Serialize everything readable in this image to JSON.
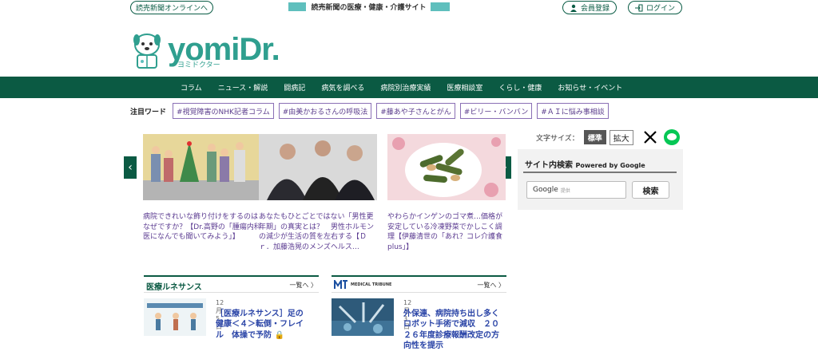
{
  "header": {
    "yomiuri_link": "読売新聞オンラインへ",
    "tagline": "読売新聞の医療・健康・介護サイト",
    "register": "会員登録",
    "login": "ログイン",
    "logo_text": "yomiDr.",
    "logo_kana": "ヨミドクター"
  },
  "nav": [
    "コラム",
    "ニュース・解説",
    "闘病記",
    "病気を調べる",
    "病院別治療実績",
    "医療相談室",
    "くらし・健康",
    "お知らせ・イベント"
  ],
  "attention": {
    "label": "注目ワード",
    "tags": [
      "#視覚障害のNHK記者コラム",
      "#由美かおるさんの呼吸法",
      "#藤あや子さんとがん",
      "#ビリー・バンバン",
      "#ＡＩに悩み事相談"
    ]
  },
  "carousel": [
    {
      "caption": "病院できれいな飾り付けをするのはなぜですか？【Dr.高野の「腫瘍内科医になんでも聞いてみよう」】"
    },
    {
      "caption": "あなたもひとごとではない「男性更年期」の真実とは？　男性ホルモンの減少が生活の質を左右する【Ｄｒ．加藤浩晃のメンズヘルス…"
    },
    {
      "caption": "やわらかインゲンのゴマ煮…価格が安定している冷凍野菜でかしこく調理【伊藤清世の「あれ？コレ介護食 plus」】"
    }
  ],
  "font_size": {
    "label": "文字サイズ：",
    "standard": "標準",
    "large": "拡大"
  },
  "search": {
    "title": "サイト内検索",
    "powered": "Powered by Google",
    "input_brand": "Google",
    "input_sub": "提供",
    "button": "検索"
  },
  "sections": [
    {
      "title": "医療ルネサンス",
      "more": "一覧へ",
      "date": "12月5日",
      "article_title": "［医療ルネサンス］足の健康＜４＞転倒・フレイル　体操で予防"
    },
    {
      "title": "MEDICAL TRIBUNE",
      "more": "一覧へ",
      "date": "12月3日",
      "article_title": "外保連、病院持ち出し多くロボット手術で減収　２０２６年度診療報酬改定の方向性を提示"
    }
  ],
  "colors": {
    "brand_green": "#0b5a43",
    "logo_teal": "#2f9f8f",
    "tag_purple": "#8a6fb5",
    "link_blue": "#2b45a7"
  }
}
